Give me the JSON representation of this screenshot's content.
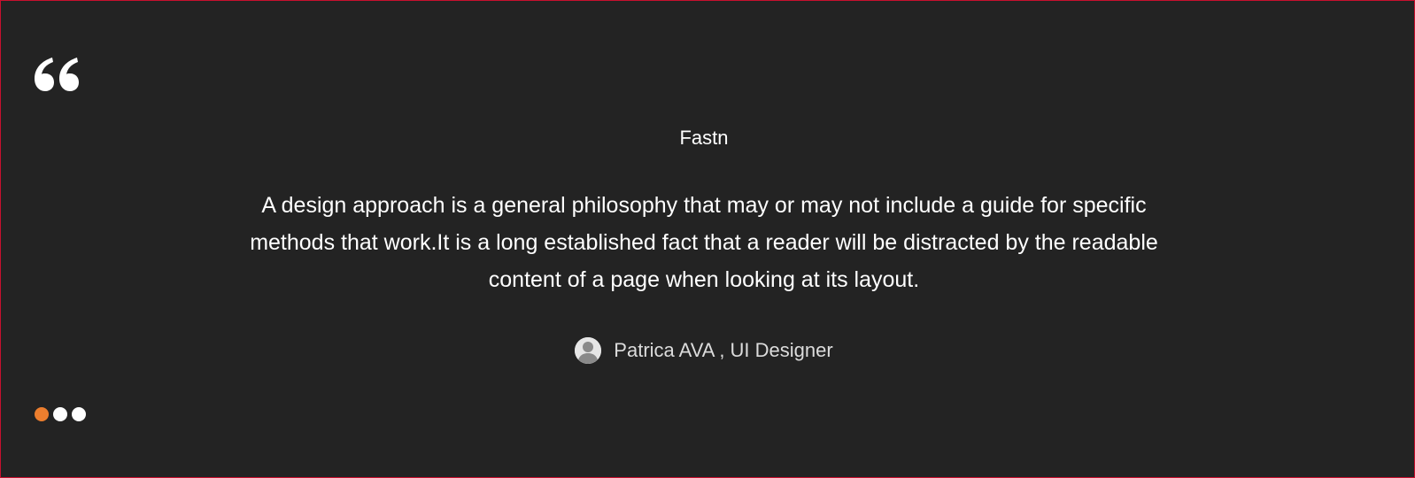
{
  "testimonial": {
    "company": "Fastn",
    "quote": "A design approach is a general philosophy that may or may not include a guide for specific methods that work.It is a long established fact that a reader will be distracted by the readable content of a page when looking at its layout.",
    "author": "Patrica AVA , UI Designer",
    "quote_icon": "quote-open-icon",
    "avatar_icon": "user-avatar-icon"
  },
  "carousel": {
    "total_slides": 3,
    "active_slide": 1,
    "colors": {
      "active": "#ec7e2e",
      "inactive": "#ffffff"
    }
  },
  "colors": {
    "background": "#232323",
    "border": "#c8102e",
    "text": "#ffffff"
  }
}
